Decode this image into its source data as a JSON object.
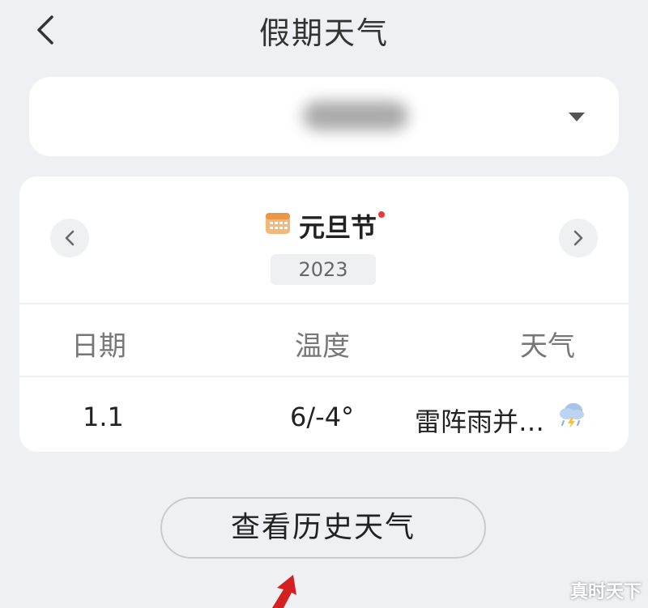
{
  "header": {
    "title": "假期天气"
  },
  "holiday": {
    "name": "元旦节",
    "year": "2023"
  },
  "table": {
    "columns": [
      "日期",
      "温度",
      "天气"
    ],
    "rows": [
      {
        "date": "1.1",
        "temp": "6/-4°",
        "weather": "雷阵雨并…",
        "icon": "thunderstorm-icon"
      }
    ]
  },
  "history_button": {
    "label": "查看历史天气"
  },
  "watermark": "真时天下",
  "colors": {
    "background": "#eef0f4",
    "card": "#ffffff",
    "accent_red": "#e43a3a",
    "calendar_orange": "#f0a45a"
  }
}
